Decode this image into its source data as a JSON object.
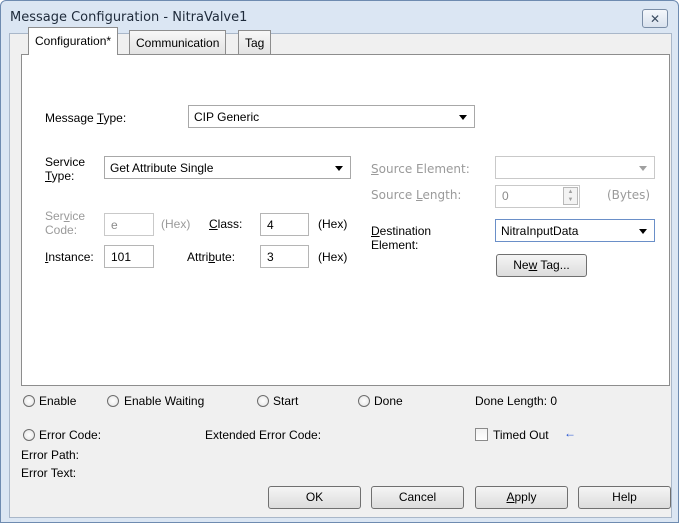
{
  "window": {
    "title": "Message Configuration - NitraValve1",
    "close_glyph": "✕"
  },
  "tabs": [
    {
      "label": "Configuration*"
    },
    {
      "label": "Communication"
    },
    {
      "label": "Tag"
    }
  ],
  "config": {
    "message_type_label_pre": "Message ",
    "message_type_label_ul": "T",
    "message_type_label_post": "ype:",
    "message_type_value": "CIP Generic",
    "service_type_label_1": "Service",
    "service_type_label_2_ul": "T",
    "service_type_label_2_post": "ype:",
    "service_type_value": "Get Attribute Single",
    "service_code_label_1_pre": "Ser",
    "service_code_label_1_ul": "v",
    "service_code_label_1_post": "ice",
    "service_code_label_2": "Code:",
    "service_code_value": "e",
    "hex_label": "(Hex)",
    "class_label_ul": "C",
    "class_label_post": "lass:",
    "class_value": "4",
    "instance_label_ul": "I",
    "instance_label_post": "nstance:",
    "instance_value": "101",
    "attribute_label_pre": "Attri",
    "attribute_label_ul": "b",
    "attribute_label_post": "ute:",
    "attribute_value": "3",
    "source_element_label_ul": "S",
    "source_element_label_post": "ource Element:",
    "source_element_value": "",
    "source_length_label_pre": "Source ",
    "source_length_label_ul": "L",
    "source_length_label_post": "ength:",
    "source_length_value": "0",
    "bytes_label": "(Bytes)",
    "destination_label_1_ul": "D",
    "destination_label_1_post": "estination",
    "destination_label_2": "Element:",
    "destination_value": "NitraInputData",
    "new_tag_pre": "Ne",
    "new_tag_ul": "w",
    "new_tag_post": " Tag..."
  },
  "status": {
    "enable": "Enable",
    "enable_waiting": "Enable Waiting",
    "start": "Start",
    "done": "Done",
    "done_length": "Done Length: 0",
    "error_code": "Error Code:",
    "extended_error_code": "Extended Error Code:",
    "timed_out": "Timed Out",
    "timed_out_arrow": "←",
    "error_path": "Error Path:",
    "error_text": "Error Text:"
  },
  "buttons": {
    "ok": "OK",
    "cancel": "Cancel",
    "apply_ul": "A",
    "apply_post": "pply",
    "help": "Help"
  },
  "colors": {
    "accent_arrow": "#1f4fd1",
    "window_frame": "#dbe6f3"
  }
}
